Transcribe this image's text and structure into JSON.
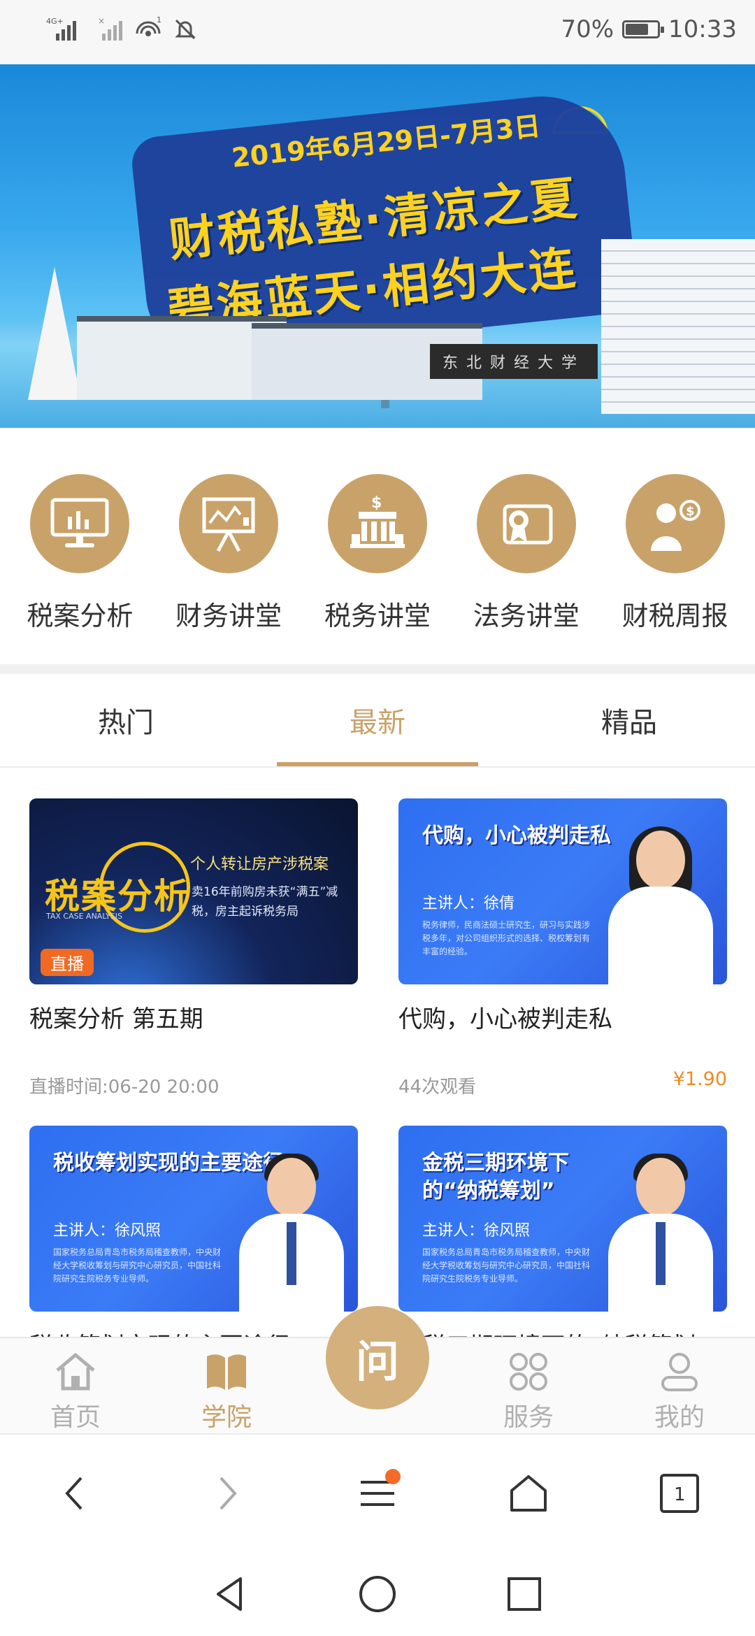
{
  "status_bar": {
    "network": "4G+",
    "battery_text": "70%",
    "battery_level": 0.7,
    "time": "10:33",
    "hotspot_count": "1"
  },
  "banner": {
    "date_text": "2019年6月29日-7月3日",
    "line1": "财税私塾·清凉之夏",
    "line2": "碧海蓝天·相约大连",
    "university_sign": "东北财经大学",
    "colors": {
      "brand_yellow": "#ffd21f",
      "brush_blue": "#1d3f9a"
    }
  },
  "categories": [
    {
      "label": "税案分析",
      "icon": "monitor-chart-icon"
    },
    {
      "label": "财务讲堂",
      "icon": "presentation-board-icon"
    },
    {
      "label": "税务讲堂",
      "icon": "tax-bureau-building-icon"
    },
    {
      "label": "法务讲堂",
      "icon": "certificate-icon"
    },
    {
      "label": "财税周报",
      "icon": "advisor-coin-icon"
    }
  ],
  "tabs": [
    {
      "label": "热门",
      "active": false
    },
    {
      "label": "最新",
      "active": true
    },
    {
      "label": "精品",
      "active": false
    }
  ],
  "cards": [
    {
      "title": "税案分析 第五期",
      "meta": "直播时间:06-20 20:00",
      "price": "",
      "thumb": {
        "logo": "税案分析",
        "logo_sub": "TAX CASE ANALYSIS",
        "heading": "个人转让房产涉税案",
        "desc": "卖16年前购房未获“满五”减税，房主起诉税务局",
        "badge": "直播"
      }
    },
    {
      "title": "代购，小心被判走私",
      "meta": "44次观看",
      "price": "¥1.90",
      "thumb": {
        "heading": "代购，小心被判走私",
        "presenter": "主讲人：徐倩",
        "desc": "税务律师，民商法硕士研究生，研习与实践涉税多年，对公司组织形式的选择、税权筹划有丰富的经验。"
      }
    },
    {
      "title": "税收筹划实现的主要途径",
      "meta": "",
      "price": "",
      "thumb": {
        "heading": "税收筹划实现的主要途径",
        "presenter": "主讲人：徐风照",
        "desc": "国家税务总局青岛市税务局稽查教师，中央财经大学税收筹划与研究中心研究员，中国社科院研究生院税务专业导师。"
      }
    },
    {
      "title": "金税三期环境下的“纳税筹划”",
      "meta": "",
      "price": "",
      "thumb": {
        "heading_line1": "金税三期环境下",
        "heading_line2": "的“纳税筹划”",
        "presenter": "主讲人：徐风照",
        "desc": "国家税务总局青岛市税务局稽查教师，中央财经大学税收筹划与研究中心研究员，中国社科院研究生院税务专业导师。"
      }
    }
  ],
  "app_nav": {
    "items": [
      {
        "label": "首页",
        "icon": "home-icon"
      },
      {
        "label": "学院",
        "icon": "book-icon"
      },
      {
        "label": "服务",
        "icon": "services-grid-icon"
      },
      {
        "label": "我的",
        "icon": "profile-icon"
      }
    ],
    "ask_label": "问",
    "active_index": 1,
    "accent": "#c8a269"
  },
  "browser_bar": {
    "tab_count": "1"
  }
}
